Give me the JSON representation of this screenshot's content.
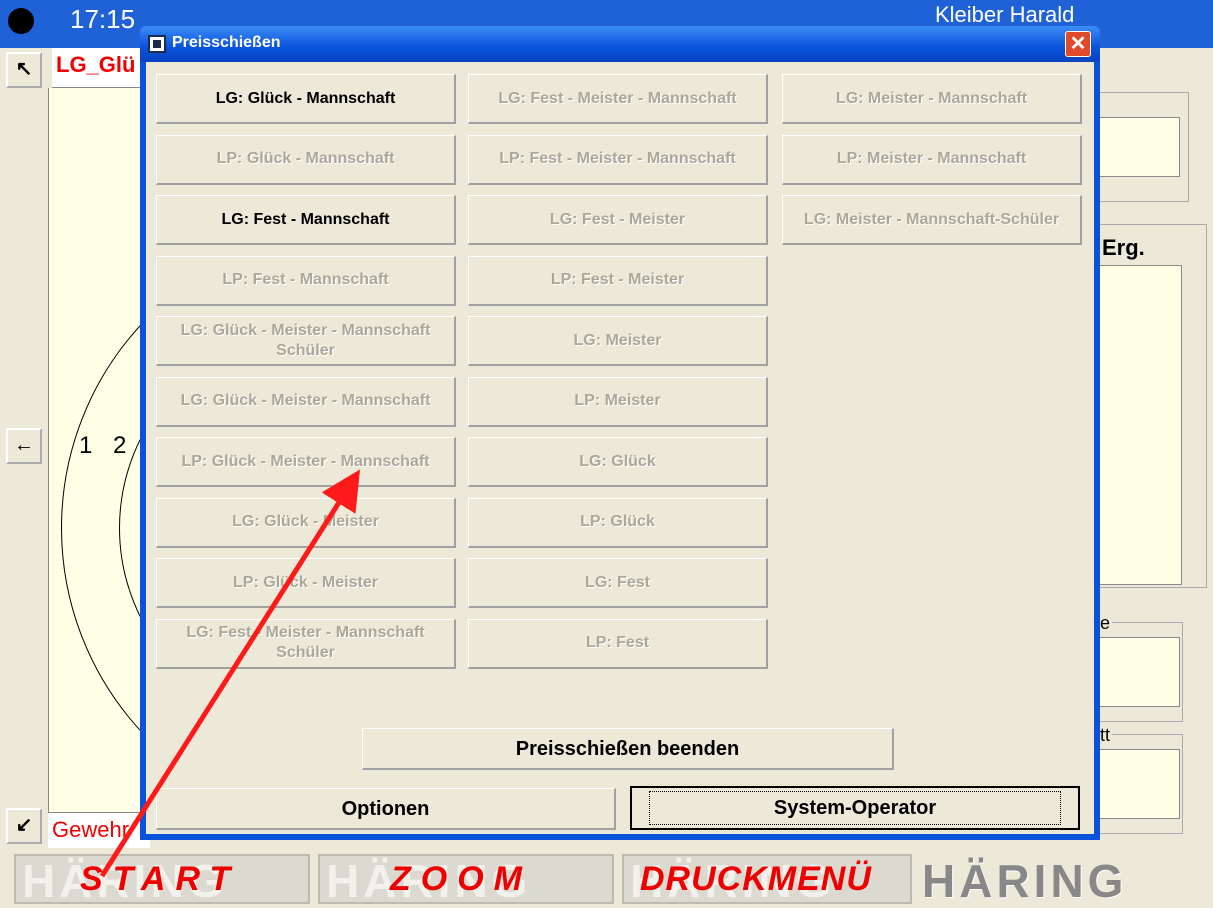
{
  "background_app": {
    "clock": "17:15",
    "shooter_label": "LG_Glü",
    "weapon_label": "Gewehr",
    "top_name": "Kleiber Harald",
    "ring_numbers": [
      "1",
      "2"
    ],
    "nav_up": "↖",
    "nav_left": "←",
    "nav_down": "↙",
    "result_header": "Erg.",
    "group_char_1": "e",
    "group_char_2": "tt",
    "bottom_buttons": [
      {
        "label": "START",
        "brand": "HÄRING"
      },
      {
        "label": "ZOOM",
        "brand": "HÄRING"
      },
      {
        "label": "DRUCKMENÜ",
        "brand": "HÄRING"
      }
    ],
    "logo": "HÄRING"
  },
  "dialog": {
    "title": "Preisschießen",
    "close_glyph": "✕",
    "col1": [
      {
        "label": "LG: Glück - Mannschaft",
        "enabled": true
      },
      {
        "label": "LP: Glück - Mannschaft",
        "enabled": false
      },
      {
        "label": "LG: Fest - Mannschaft",
        "enabled": true
      },
      {
        "label": "LP: Fest - Mannschaft",
        "enabled": false
      },
      {
        "label": "LG: Glück - Meister - Mannschaft Schüler",
        "enabled": false
      },
      {
        "label": "LG: Glück - Meister - Mannschaft",
        "enabled": false
      },
      {
        "label": "LP: Glück - Meister - Mannschaft",
        "enabled": false
      },
      {
        "label": "LG: Glück - Meister",
        "enabled": false
      },
      {
        "label": "LP: Glück - Meister",
        "enabled": false
      },
      {
        "label": "LG: Fest - Meister - Mannschaft Schüler",
        "enabled": false
      }
    ],
    "col2": [
      {
        "label": "LG: Fest - Meister - Mannschaft",
        "enabled": false
      },
      {
        "label": "LP: Fest - Meister - Mannschaft",
        "enabled": false
      },
      {
        "label": "LG: Fest - Meister",
        "enabled": false
      },
      {
        "label": "LP: Fest - Meister",
        "enabled": false
      },
      {
        "label": "LG: Meister",
        "enabled": false
      },
      {
        "label": "LP: Meister",
        "enabled": false
      },
      {
        "label": "LG: Glück",
        "enabled": false
      },
      {
        "label": "LP: Glück",
        "enabled": false
      },
      {
        "label": "LG: Fest",
        "enabled": false
      },
      {
        "label": "LP: Fest",
        "enabled": false
      }
    ],
    "col3": [
      {
        "label": "LG: Meister - Mannschaft",
        "enabled": false
      },
      {
        "label": "LP: Meister - Mannschaft",
        "enabled": false
      },
      {
        "label": "LG: Meister - Mannschaft-Schüler",
        "enabled": false
      }
    ],
    "end_button": "Preisschießen beenden",
    "options_button": "Optionen",
    "sysop_button": "System-Operator"
  },
  "colors": {
    "titlebar": "#0a52dc",
    "disabled_text": "#aca899",
    "accent_red": "#e00000",
    "annotation_arrow": "#ff0000"
  }
}
